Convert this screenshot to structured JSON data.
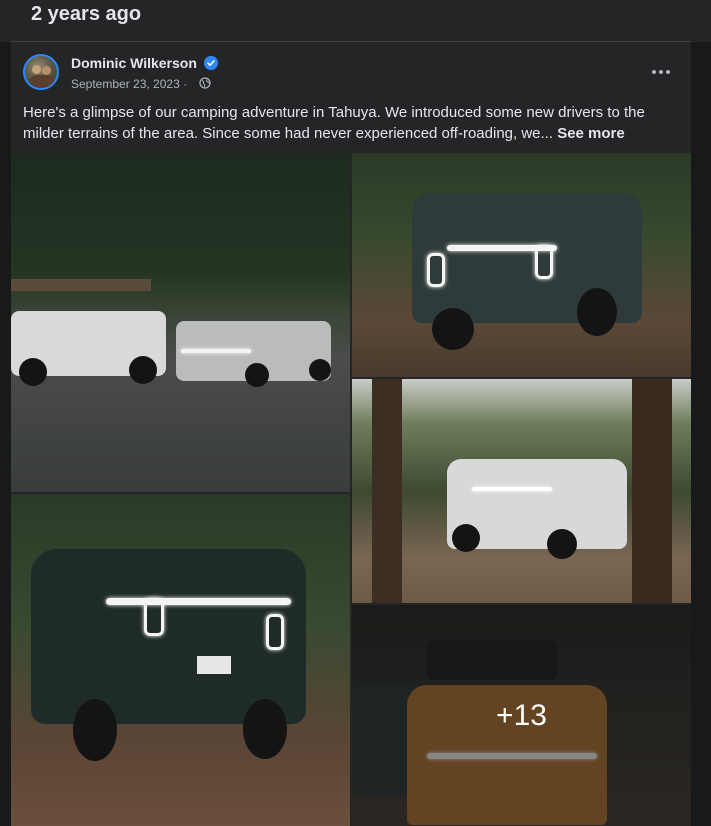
{
  "memory": {
    "title": "2 years ago"
  },
  "post": {
    "author": "Dominic Wilkerson",
    "date": "September 23, 2023 ·",
    "text": "Here's a glimpse of our camping adventure in Tahuya. We introduced some new drivers to the milder terrains of the area. Since some had never experienced off-roading, we...",
    "see_more": "See more",
    "photos_more_count": "+13"
  },
  "icons": {
    "verified": "verified-badge-icon",
    "privacy": "globe-icon",
    "more": "more-options-icon"
  },
  "colors": {
    "background": "#18191a",
    "card": "#242526",
    "text_primary": "#e4e6eb",
    "text_secondary": "#b0b3b8",
    "verified_blue": "#2d88ff"
  }
}
